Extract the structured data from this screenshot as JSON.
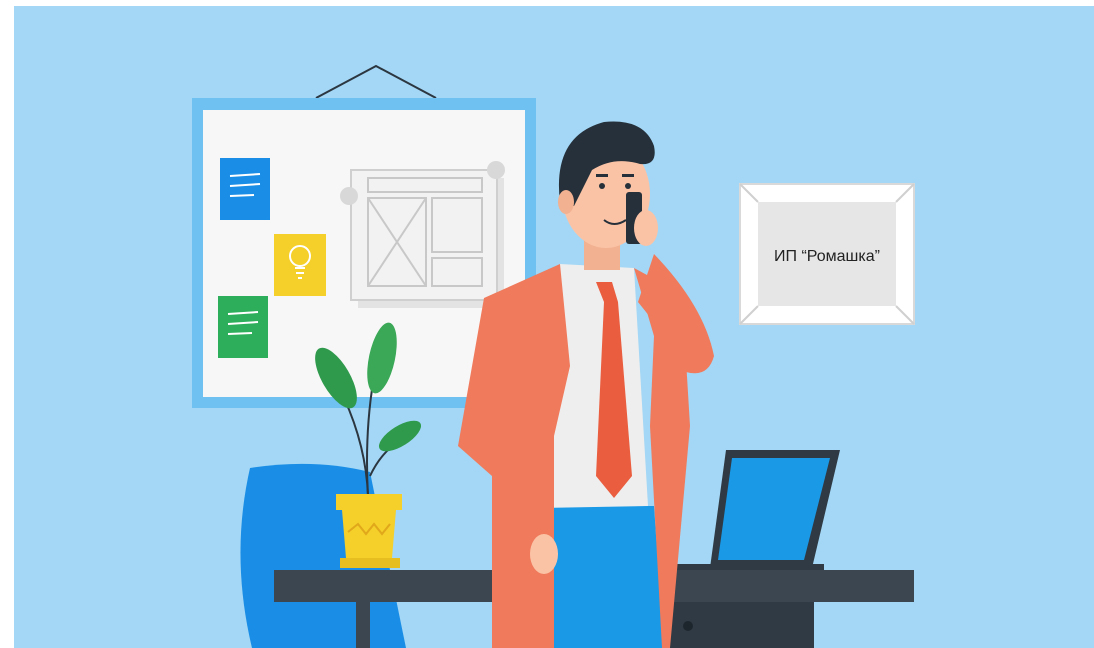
{
  "scene": {
    "sign": {
      "text": "ИП “Ромашка”"
    }
  },
  "colors": {
    "wall": "#a3d7f5",
    "board_frame": "#6ec1f0",
    "board_surface": "#f7f7f7",
    "jacket": "#f07a5c",
    "tie": "#ea5e3f",
    "shirt": "#eeeeee",
    "trousers": "#1a99e6",
    "hair": "#25303a",
    "skin": "#fbc3a6",
    "desk": "#3c4650",
    "chair": "#1a8ee6",
    "pot": "#f5cf2a",
    "leaf": "#3aa856",
    "note_blue": "#1a8ee6",
    "note_yellow": "#f5cf2a",
    "note_green": "#2dae5a",
    "laptop_screen": "#1a99e6"
  }
}
